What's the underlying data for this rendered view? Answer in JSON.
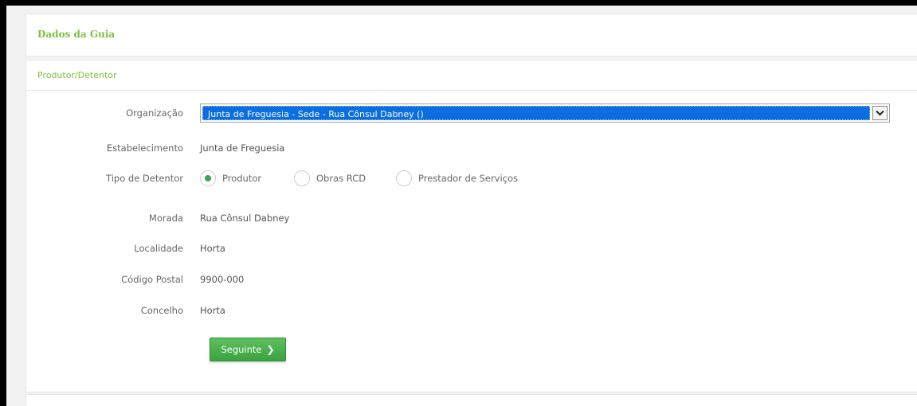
{
  "panel": {
    "title": "Dados da Guia"
  },
  "section": {
    "title": "Produtor/Detentor"
  },
  "form": {
    "organizacao": {
      "label": "Organização",
      "selected": "Junta de Freguesia - Sede - Rua Cônsul Dabney ()"
    },
    "estabelecimento": {
      "label": "Estabelecimento",
      "value": "Junta de Freguesia"
    },
    "tipo_detentor": {
      "label": "Tipo de Detentor",
      "options": [
        "Produtor",
        "Obras RCD",
        "Prestador de Serviços"
      ],
      "selected": "Produtor"
    },
    "morada": {
      "label": "Morada",
      "value": "Rua Cônsul Dabney"
    },
    "localidade": {
      "label": "Localidade",
      "value": "Horta"
    },
    "codigo_postal": {
      "label": "Código Postal",
      "value": "9900-000"
    },
    "concelho": {
      "label": "Concelho",
      "value": "Horta"
    }
  },
  "buttons": {
    "next_label": "Seguinte",
    "next_icon": "chevron-right-icon"
  },
  "colors": {
    "accent": "#7dc142",
    "button": "#3aa340",
    "select_highlight": "#0a6ee0"
  }
}
